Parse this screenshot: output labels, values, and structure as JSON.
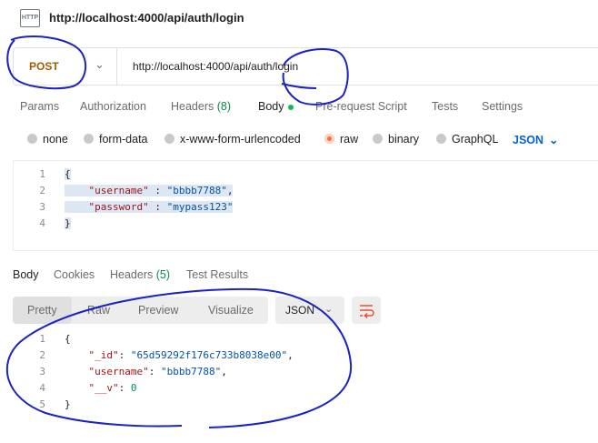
{
  "window": {
    "title": "http://localhost:4000/api/auth/login",
    "badge": "HTTP"
  },
  "request": {
    "method": "POST",
    "url": "http://localhost:4000/api/auth/login"
  },
  "request_tabs": {
    "params": "Params",
    "authorization": "Authorization",
    "headers": "Headers",
    "headers_count": "(8)",
    "body": "Body",
    "pre_request": "Pre-request Script",
    "tests": "Tests",
    "settings": "Settings"
  },
  "body_types": {
    "none": "none",
    "form_data": "form-data",
    "urlencoded": "x-www-form-urlencoded",
    "raw": "raw",
    "binary": "binary",
    "graphql": "GraphQL",
    "format": "JSON"
  },
  "request_body": {
    "line_numbers": [
      "1",
      "2",
      "3",
      "4"
    ],
    "open": "{",
    "username_key": "\"username\"",
    "username_value": "\"bbbb7788\"",
    "password_key": "\"password\"",
    "password_value": "\"mypass123\"",
    "close": "}"
  },
  "response_tabs": {
    "body": "Body",
    "cookies": "Cookies",
    "headers": "Headers",
    "headers_count": "(5)",
    "test_results": "Test Results"
  },
  "response_view": {
    "pretty": "Pretty",
    "raw": "Raw",
    "preview": "Preview",
    "visualize": "Visualize",
    "format": "JSON"
  },
  "response_body": {
    "line_numbers": [
      "1",
      "2",
      "3",
      "4",
      "5"
    ],
    "open": "{",
    "id_key": "\"_id\"",
    "id_value": "\"65d59292f176c733b8038e00\"",
    "username_key": "\"username\"",
    "username_value": "\"bbbb7788\"",
    "v_key": "\"__v\"",
    "v_value": "0",
    "close": "}"
  },
  "colors": {
    "method": "#a15c00",
    "selected_radio": "#ff6c37",
    "link_blue": "#0265d2",
    "annotation_ink": "#1a22c4"
  }
}
